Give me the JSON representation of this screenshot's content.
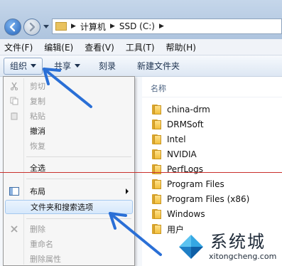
{
  "address": {
    "crumbs": [
      "计算机",
      "SSD (C:)"
    ]
  },
  "menubar": {
    "items": [
      "文件(F)",
      "编辑(E)",
      "查看(V)",
      "工具(T)",
      "帮助(H)"
    ]
  },
  "toolbar": {
    "organize_label": "组织",
    "share_label": "共享",
    "burn_label": "刻录",
    "new_folder_label": "新建文件夹"
  },
  "content": {
    "column_header": "名称",
    "folders": [
      "china-drm",
      "DRMSoft",
      "Intel",
      "NVIDIA",
      "PerfLogs",
      "Program Files",
      "Program Files (x86)",
      "Windows",
      "用户"
    ]
  },
  "organize_menu": {
    "cut": "剪切",
    "copy": "复制",
    "paste": "粘贴",
    "undo": "撤消",
    "redo": "恢复",
    "select_all": "全选",
    "layout": "布局",
    "folder_options": "文件夹和搜索选项",
    "delete": "删除",
    "rename": "重命名",
    "remove_properties": "删除属性"
  },
  "watermark": {
    "name": "系统城",
    "url": "xitongcheng.com"
  },
  "colors": {
    "annotation_arrow": "#2a6fd6",
    "red_line": "#c9302c"
  }
}
